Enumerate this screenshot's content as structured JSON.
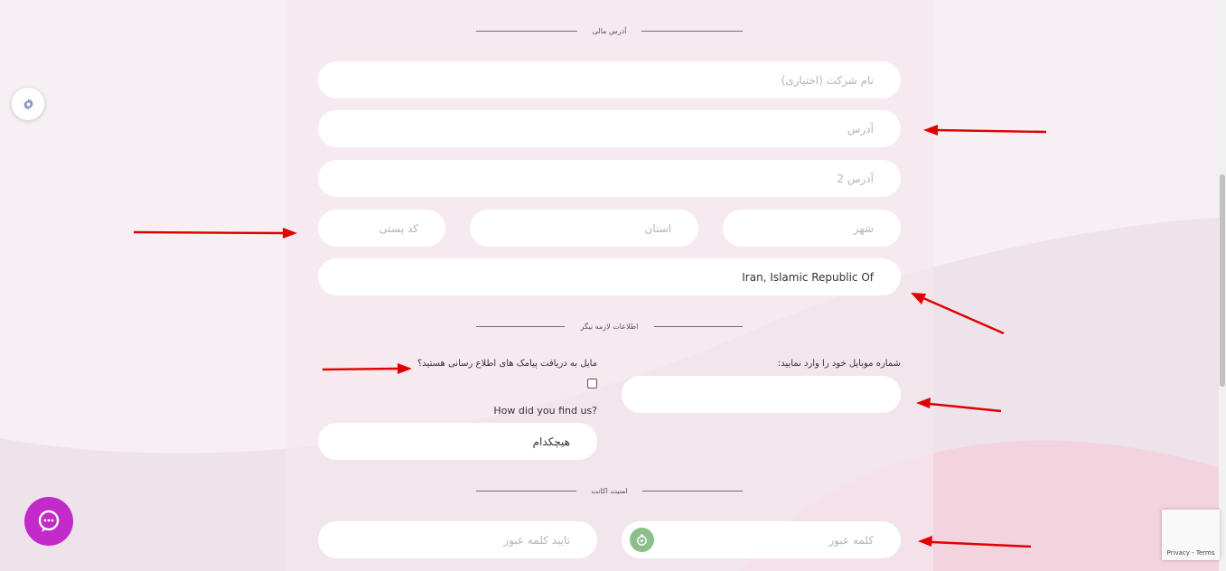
{
  "sections": {
    "billing_address": "آدرس مالی",
    "required_info": "اطلاعات لازمه نیگر",
    "account_security": "امنیت اکانت"
  },
  "fields": {
    "company": {
      "placeholder": "نام شرکت (اختیاری)"
    },
    "address": {
      "placeholder": "آدرس"
    },
    "address2": {
      "placeholder": "آدرس 2"
    },
    "city": {
      "placeholder": "شهر"
    },
    "state": {
      "placeholder": "استان"
    },
    "postcode": {
      "placeholder": "کد پستی"
    },
    "country": {
      "value": "Iran, Islamic Republic Of"
    },
    "mobile": {
      "label": "شماره موبایل خود را وارد نمایید:",
      "value": ""
    },
    "sms_optin": {
      "label": "مایل به دریافت پیامک های اطلاع رسانی هستید؟",
      "checked": false
    },
    "referral": {
      "label": "How did you find us?",
      "value": "هیچکدام"
    },
    "password": {
      "placeholder": "کلمه عبور"
    },
    "confirm_password": {
      "placeholder": "تایید کلمه عبور"
    }
  },
  "widgets": {
    "settings_icon": "gear-icon",
    "chat_icon": "chat-bubble-icon",
    "password_reveal_icon": "eye-icon",
    "recaptcha": "Privacy - Terms"
  },
  "colors": {
    "accent_chat": "#c22bc9",
    "arrow": "#e00000",
    "eye_button": "#8cc08b"
  }
}
